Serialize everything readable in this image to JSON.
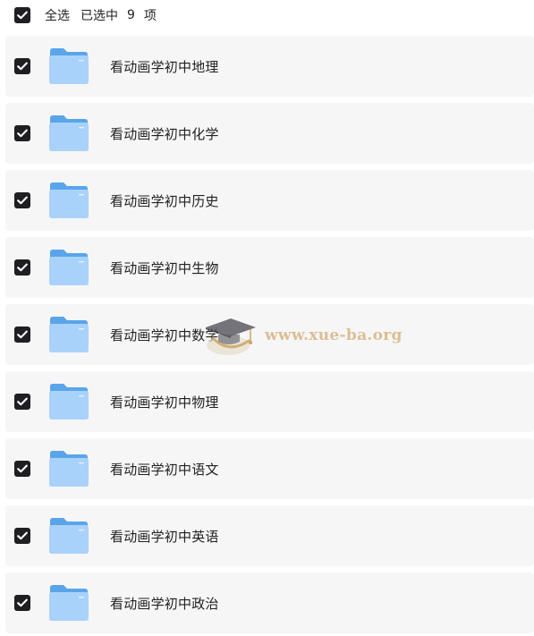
{
  "header": {
    "select_all_label": "全选",
    "selected_prefix": "已选中",
    "selected_count": "9",
    "selected_suffix": "项"
  },
  "items": [
    {
      "label": "看动画学初中地理",
      "checked": true
    },
    {
      "label": "看动画学初中化学",
      "checked": true
    },
    {
      "label": "看动画学初中历史",
      "checked": true
    },
    {
      "label": "看动画学初中生物",
      "checked": true
    },
    {
      "label": "看动画学初中数学",
      "checked": true
    },
    {
      "label": "看动画学初中物理",
      "checked": true
    },
    {
      "label": "看动画学初中语文",
      "checked": true
    },
    {
      "label": "看动画学初中英语",
      "checked": true
    },
    {
      "label": "看动画学初中政治",
      "checked": true
    }
  ],
  "watermark": {
    "text": "www.xue-ba.org"
  },
  "colors": {
    "checkbox": "#1f1f22",
    "row_background": "#f6f6f6",
    "folder_back": "#5aa5ea",
    "folder_front": "#a9d2fb",
    "watermark_text": "#d9b98a"
  },
  "icons": {
    "checkbox": "check-icon",
    "folder": "folder-icon",
    "watermark": "graduation-cap-icon"
  }
}
